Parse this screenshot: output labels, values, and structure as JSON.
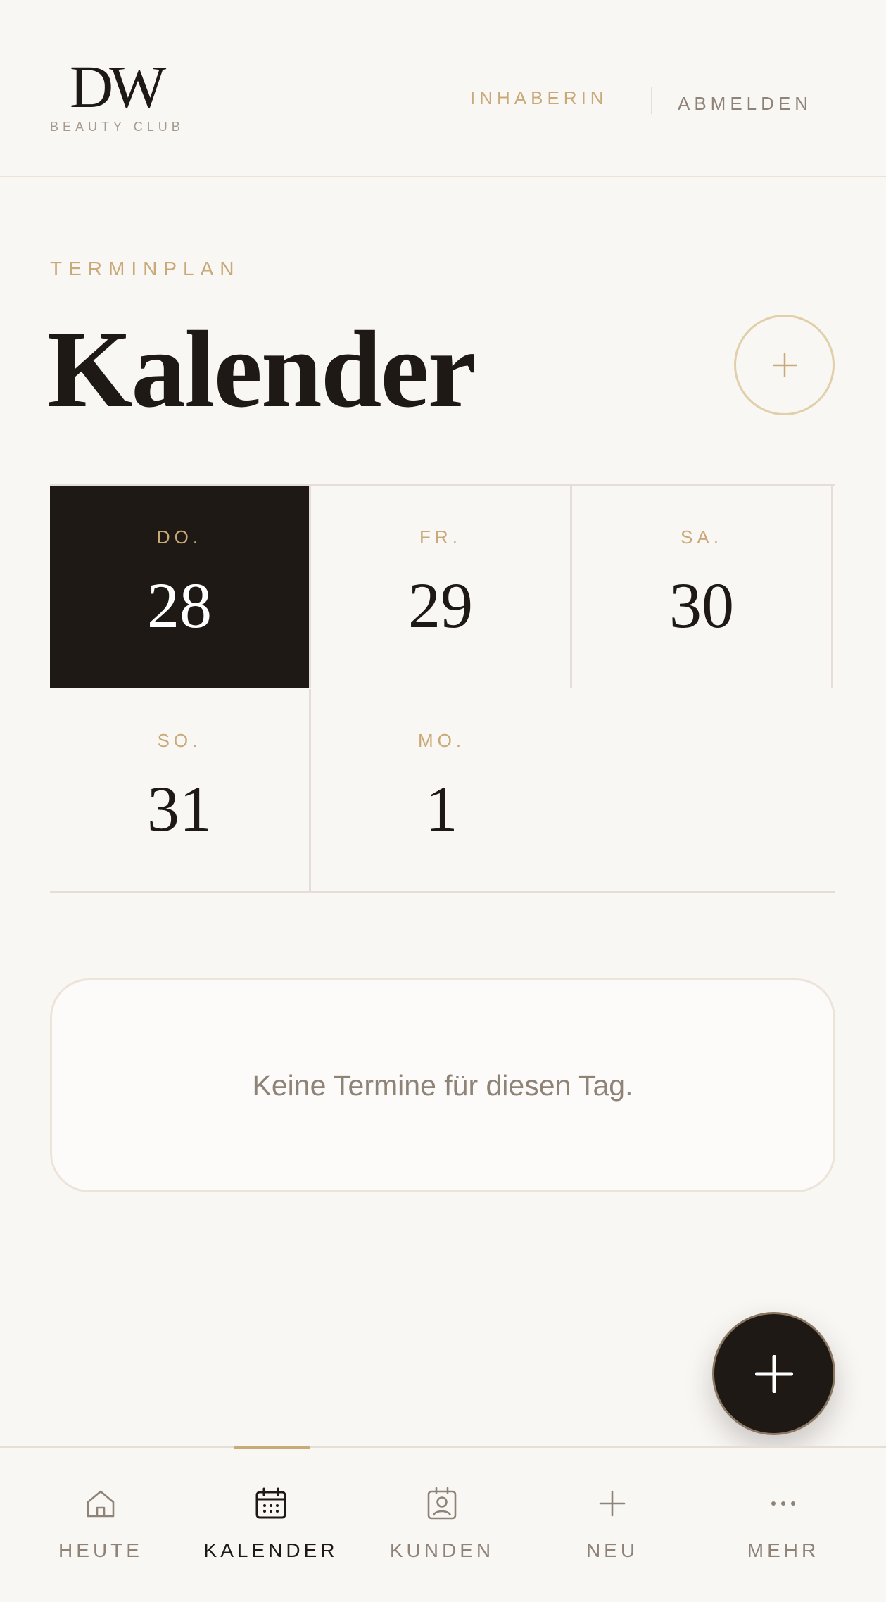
{
  "header": {
    "logo_mark": "DW",
    "logo_subtitle": "BEAUTY CLUB",
    "role": "INHABERIN",
    "logout": "ABMELDEN"
  },
  "page": {
    "eyebrow": "TERMINPLAN",
    "title": "Kalender"
  },
  "days": [
    {
      "label": "DO.",
      "number": "28",
      "selected": true
    },
    {
      "label": "FR.",
      "number": "29",
      "selected": false
    },
    {
      "label": "SA.",
      "number": "30",
      "selected": false
    },
    {
      "label": "SO.",
      "number": "31",
      "selected": false
    },
    {
      "label": "MO.",
      "number": "1",
      "selected": false
    }
  ],
  "empty_state": "Keine Termine für diesen Tag.",
  "nav": [
    {
      "label": "HEUTE",
      "icon": "home-icon",
      "active": false
    },
    {
      "label": "KALENDER",
      "icon": "calendar-icon",
      "active": true
    },
    {
      "label": "KUNDEN",
      "icon": "contact-icon",
      "active": false
    },
    {
      "label": "NEU",
      "icon": "plus-icon",
      "active": false
    },
    {
      "label": "MEHR",
      "icon": "more-icon",
      "active": false
    }
  ],
  "colors": {
    "accent_gold": "#c9a978",
    "dark": "#1e1915",
    "muted": "#8f8378",
    "background": "#f9f7f4"
  }
}
